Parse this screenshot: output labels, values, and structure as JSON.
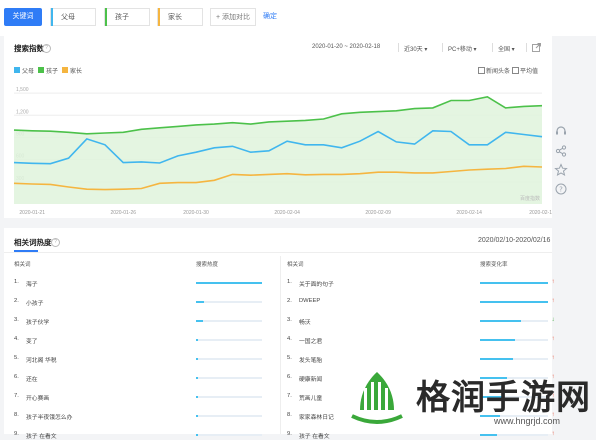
{
  "topbar": {
    "main_keyword": "关键词",
    "keywords": [
      {
        "label": "父母",
        "color": "#40b6ee"
      },
      {
        "label": "孩子",
        "color": "#4cc14a"
      },
      {
        "label": "家长",
        "color": "#f5b540"
      }
    ],
    "add_compare": "+ 添加对比",
    "confirm": "确定"
  },
  "trend": {
    "title": "搜索指数",
    "date_range": "2020-01-20 ~ 2020-02-18",
    "period": "近30天",
    "device": "PC+移动",
    "region": "全国",
    "options": [
      "新闻头条",
      "平均值"
    ],
    "watermark": "百度指数"
  },
  "chart_data": {
    "type": "area",
    "x": [
      "2020-01-20",
      "2020-01-21",
      "2020-01-22",
      "2020-01-23",
      "2020-01-24",
      "2020-01-25",
      "2020-01-26",
      "2020-01-27",
      "2020-01-28",
      "2020-01-29",
      "2020-01-30",
      "2020-01-31",
      "2020-02-01",
      "2020-02-02",
      "2020-02-03",
      "2020-02-04",
      "2020-02-05",
      "2020-02-06",
      "2020-02-07",
      "2020-02-08",
      "2020-02-09",
      "2020-02-10",
      "2020-02-11",
      "2020-02-12",
      "2020-02-13",
      "2020-02-14",
      "2020-02-15",
      "2020-02-16",
      "2020-02-17",
      "2020-02-18"
    ],
    "xticks": [
      "2020-01-21",
      "2020-01-26",
      "2020-01-30",
      "2020-02-04",
      "2020-02-09",
      "2020-02-14",
      "2020-02-18"
    ],
    "yticks": [
      "1,500",
      "1,200",
      "900",
      "600",
      "300"
    ],
    "ylim": [
      0,
      1650
    ],
    "series": [
      {
        "name": "父母",
        "color": "#40b6ee",
        "values": [
          560,
          550,
          545,
          620,
          880,
          800,
          560,
          570,
          555,
          650,
          700,
          760,
          780,
          700,
          720,
          850,
          800,
          800,
          760,
          850,
          980,
          840,
          810,
          990,
          980,
          800,
          800,
          970,
          940,
          910
        ]
      },
      {
        "name": "孩子",
        "color": "#4cc14a",
        "values": [
          1000,
          990,
          985,
          970,
          950,
          960,
          970,
          1010,
          1030,
          1050,
          1070,
          1080,
          1100,
          1080,
          1110,
          1120,
          1130,
          1150,
          1220,
          1240,
          1250,
          1260,
          1290,
          1300,
          1400,
          1400,
          1450,
          1300,
          1320,
          1330
        ]
      },
      {
        "name": "家长",
        "color": "#f5b540",
        "values": [
          280,
          270,
          265,
          230,
          200,
          195,
          200,
          210,
          280,
          290,
          290,
          320,
          400,
          390,
          400,
          410,
          395,
          400,
          400,
          410,
          430,
          430,
          420,
          420,
          440,
          460,
          470,
          480,
          510,
          500
        ]
      }
    ]
  },
  "related": {
    "title": "相关词热度",
    "date_range": "2020/02/10-2020/02/16",
    "left_col_header": "相关词",
    "left_val_header": "搜索热度",
    "right_col_header": "相关词",
    "right_val_header": "搜索变化率",
    "left_rows": [
      {
        "rank": "1.",
        "word": "海子",
        "heat": 1.0
      },
      {
        "rank": "2.",
        "word": "小孩子",
        "heat": 0.12
      },
      {
        "rank": "3.",
        "word": "孩子伙学",
        "heat": 0.1
      },
      {
        "rank": "4.",
        "word": "变了",
        "heat": 0.02
      },
      {
        "rank": "5.",
        "word": "河北阁 华税",
        "heat": 0.02
      },
      {
        "rank": "6.",
        "word": "还在",
        "heat": 0.01
      },
      {
        "rank": "7.",
        "word": "开心赛画",
        "heat": 0.01
      },
      {
        "rank": "8.",
        "word": "孩子半夜饿怎么办",
        "heat": 0.01
      },
      {
        "rank": "9.",
        "word": "孩子 在看文",
        "heat": 0.01
      }
    ],
    "right_rows": [
      {
        "rank": "1.",
        "word": "关于面的句子",
        "rate": 1.0,
        "dir": "up"
      },
      {
        "rank": "2.",
        "word": "DWEEP",
        "rate": 1.0,
        "dir": "up"
      },
      {
        "rank": "3.",
        "word": "畅沃",
        "rate": 0.6,
        "dir": "down"
      },
      {
        "rank": "4.",
        "word": "一国之君",
        "rate": 0.52,
        "dir": "up"
      },
      {
        "rank": "5.",
        "word": "发头笔胎",
        "rate": 0.48,
        "dir": "up"
      },
      {
        "rank": "6.",
        "word": "硬康新闻",
        "rate": 0.4,
        "dir": "up"
      },
      {
        "rank": "7.",
        "word": "荒画儿童",
        "rate": 0.35,
        "dir": "up"
      },
      {
        "rank": "8.",
        "word": "家家森林日记",
        "rate": 0.3,
        "dir": "up"
      },
      {
        "rank": "9.",
        "word": "孩子 在看文",
        "rate": 0.25,
        "dir": "up"
      }
    ]
  },
  "overlay": {
    "brand": "格润手游网",
    "url": "www.hngrjd.com"
  }
}
